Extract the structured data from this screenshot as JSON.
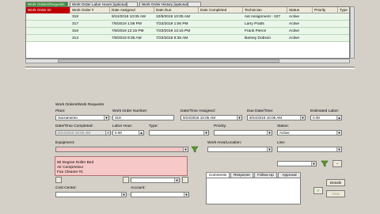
{
  "tabs": [
    {
      "label": "Work Orders/Requests",
      "active": true
    },
    {
      "label": "Work Order Labor Hours [optional]",
      "active": false
    },
    {
      "label": "Work Order History [optional]",
      "active": false
    }
  ],
  "grid": {
    "columns": [
      "Work Order ID",
      "Work Order #",
      "Date Assigned",
      "Date Due",
      "Date Completed",
      "Technician",
      "Status",
      "Priority",
      "Type"
    ],
    "rows": [
      [
        "318",
        "318",
        "8/24/2019 10:05 AM",
        "10/8/2019 10:05 AM",
        "",
        "not Assignment - 327",
        "Active",
        "",
        ""
      ],
      [
        "317",
        "317",
        "7/8/2019 1:06 PM",
        "7/23/2019 1:06 PM",
        "",
        "Larry Pratts",
        "Active",
        "",
        ""
      ],
      [
        "316",
        "316",
        "7/8/2019 12:16 PM",
        "7/23/2019 12:16 PM",
        "",
        "Frank Pierce",
        "Active",
        "",
        ""
      ],
      [
        "314",
        "314",
        "7/8/2019 9:36 AM",
        "7/23/2019 9:36 AM",
        "",
        "Barney Dobson",
        "Active",
        "",
        ""
      ]
    ]
  },
  "form": {
    "section_title": "Work Orders/Work Requests",
    "plant_label": "Plant:",
    "plant_value": "Sacramento",
    "wo_number_label": "Work Order Number:",
    "wo_number_value": "319",
    "date_assigned_label": "Date/Time Assigned:",
    "date_assigned_value": "9/24/2019 10:05 AM",
    "due_label": "Due Date/Time:",
    "due_value": "9/24/2019 10:05 AM",
    "est_labor_label": "Estimated Labor:",
    "est_labor_value": "0.00",
    "completed_label": "Date/Time Completed:",
    "completed_value": "9/24/2019 10:05 AM",
    "labor_hour_label": "Labor Hour:",
    "labor_hour_value": "0.00",
    "type_label": "Type:",
    "type_value": "",
    "priority_label": "Priority:",
    "priority_value": "",
    "status_label": "Status:",
    "status_value": "Active",
    "equipment_label": "Equipment:",
    "equipment_value": "",
    "work_area_label": "Work Area/Location:",
    "work_area_value": "",
    "line_label": "Line:",
    "line_value": "",
    "equipment_options": [
      "90 Degree Roller Bed",
      "Air Compressor",
      "Fan Cleaner #1"
    ],
    "cost_center_label": "Cost Center:",
    "cost_center_value": "",
    "account_label": "Account:",
    "account_value": ""
  },
  "comment_tabs": [
    "Comments",
    "Response",
    "Follow-Up",
    "Approval"
  ],
  "buttons": {
    "details": "Details",
    "save": "✓",
    "view": "View"
  },
  "colors": {
    "active_tab": "#3c8c3c",
    "header_accent": "#c00000",
    "row_bg": "#eaf6ea",
    "dropdown_bg": "#f7c8c8",
    "funnel": "#5a9a2a"
  },
  "icons": {
    "dropdown": "chevron-down-icon",
    "filter": "funnel-icon",
    "checkmark": "check-icon"
  }
}
